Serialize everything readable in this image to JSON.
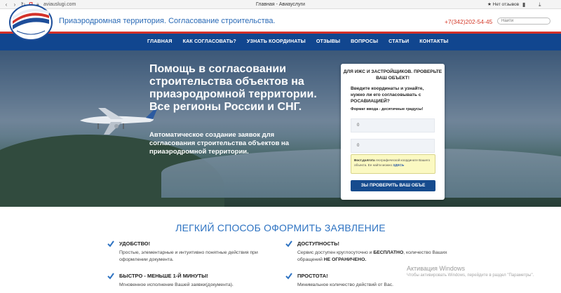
{
  "browser": {
    "url": "aviauslugi.com",
    "tab_title": "Главная - Авиауслуги",
    "reviews_label": "Нет отзывов"
  },
  "header": {
    "site_title": "Приаэродромная территория. Согласование строительства.",
    "phone": "+7(342)202-54-45",
    "search_placeholder": "Найти"
  },
  "nav": {
    "items": [
      "ГЛАВНАЯ",
      "КАК СОГЛАСОВАТЬ?",
      "УЗНАТЬ КООРДИНАТЫ",
      "ОТЗЫВЫ",
      "ВОПРОСЫ",
      "СТАТЬИ",
      "КОНТАКТЫ"
    ]
  },
  "hero": {
    "title": "Помощь в согласовании строительства объектов на приаэродромной территории. Все регионы России и СНГ.",
    "subtitle": "Автоматическое создание заявок для согласования строительства объектов на приаэродромной территории."
  },
  "form": {
    "heading": "ДЛЯ ИЖС И ЗАСТРОЙЩИКОВ. ПРОВЕРЬТЕ ВАШ ОБЪЕКТ!",
    "description": "Введите координаты и узнайте, нужно ли его согласовывать с РОСАВИАЦИЕЙ?",
    "format_note": "Формат ввода - десятичные градусы!",
    "lat_value": "0",
    "lon_value": "0",
    "hint_bold": "Вост.долгота",
    "hint_text": " географической координате Вашего объекта. Ее найти можно ",
    "hint_link": "ЗДЕСЬ",
    "button_label": "ЗЫ ПРОВЕРИТЬ ВАШ ОБЪЕ"
  },
  "section": {
    "title": "ЛЕГКИЙ СПОСОБ ОФОРМИТЬ ЗАЯВЛЕНИЕ"
  },
  "features": {
    "f1_title": "УДОБСТВО!",
    "f1_desc": "Простые, элементарные и интуитивно понятные действия при оформлении документа.",
    "f2_title": "ДОСТУПНОСТЬ!",
    "f2_a": "Сервис доступен круглосуточно и ",
    "f2_b": "БЕСПЛАТНО",
    "f2_c": ", количество Ваших обращений ",
    "f2_d": "НЕ ОГРАНИЧЕНО.",
    "f3_title": "БЫСТРО - МЕНЬШЕ 1-Й МИНУТЫ!",
    "f3_desc": "Мгновенное исполнение Вашей заявки(документа).",
    "f4_title": "ПРОСТОТА!",
    "f4_desc": "Минимальное количество действий от Вас."
  },
  "watermark": {
    "title": "Активация Windows",
    "subtitle": "Чтобы активировать Windows, перейдите в раздел \"Параметры\"."
  },
  "colors": {
    "nav_bg": "#11468f",
    "accent_red": "#d3322a",
    "title_blue": "#2e73c2",
    "button_bg": "#164b8e",
    "check_blue": "#2e73c2"
  }
}
